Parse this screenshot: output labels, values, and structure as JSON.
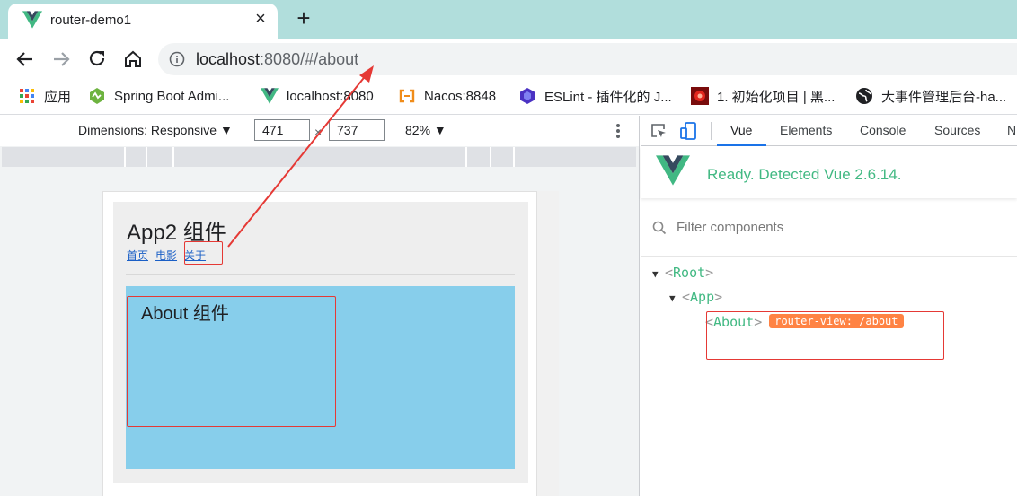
{
  "browser": {
    "tab_title": "router-demo1",
    "new_tab": "+",
    "close": "×",
    "url_host": "localhost",
    "url_rest": ":8080/#/about"
  },
  "bookmarks": [
    {
      "label": "应用",
      "icon": "apps-grid-icon"
    },
    {
      "label": "Spring Boot Admi...",
      "icon": "spring-boot-admin-icon"
    },
    {
      "label": "localhost:8080",
      "icon": "vue-icon"
    },
    {
      "label": "Nacos:8848",
      "icon": "nacos-icon"
    },
    {
      "label": "ESLint - 插件化的 J...",
      "icon": "eslint-icon"
    },
    {
      "label": "1. 初始化项目 | 黑...",
      "icon": "red-logo-icon"
    },
    {
      "label": "大事件管理后台-ha...",
      "icon": "globe-icon"
    }
  ],
  "device_toolbar": {
    "dimensions_label": "Dimensions: Responsive ▼",
    "width": "471",
    "height": "737",
    "times": "×",
    "zoom": "82% ▼"
  },
  "page": {
    "app_title": "App2 组件",
    "links": [
      "首页",
      "电影",
      "关于"
    ],
    "about_title": "About 组件",
    "router_view_color": "#87ceeb"
  },
  "devtools": {
    "tabs": [
      "Vue",
      "Elements",
      "Console",
      "Sources",
      "N"
    ],
    "active_tab": "Vue",
    "ready_text": "Ready. Detected Vue 2.6.14.",
    "filter_placeholder": "Filter components",
    "tree": {
      "root": "Root",
      "app": "App",
      "about": "About",
      "badge": "router-view: /about"
    },
    "vue_green": "#42b983",
    "badge_color": "#ff8344"
  },
  "annotation_color": "#e53935"
}
